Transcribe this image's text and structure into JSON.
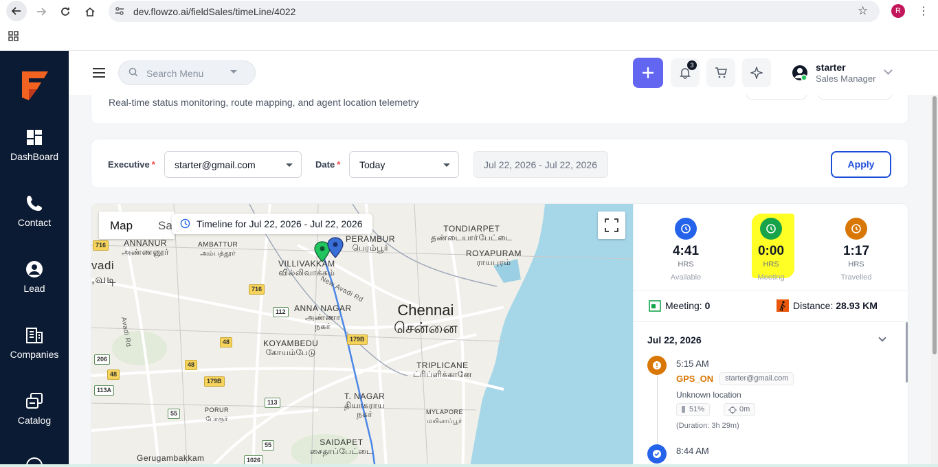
{
  "browser": {
    "url": "dev.flowzo.ai/fieldSales/timeLine/4022",
    "profile_initial": "R"
  },
  "sidebar": {
    "items": [
      {
        "label": "DashBoard",
        "icon": "dashboard-icon"
      },
      {
        "label": "Contact",
        "icon": "phone-icon"
      },
      {
        "label": "Lead",
        "icon": "user-circle-icon"
      },
      {
        "label": "Companies",
        "icon": "building-icon"
      },
      {
        "label": "Catalog",
        "icon": "catalog-icon"
      }
    ]
  },
  "header": {
    "search_placeholder": "Search Menu",
    "notification_count": "3",
    "user_name": "starter",
    "user_role": "Sales Manager"
  },
  "page": {
    "description": "Real-time status monitoring, route mapping, and agent location telemetry"
  },
  "filters": {
    "executive_label": "Executive",
    "executive_value": "starter@gmail.com",
    "date_label": "Date",
    "date_value": "Today",
    "date_range": "Jul 22, 2026 - Jul 22, 2026",
    "apply_label": "Apply"
  },
  "map": {
    "tab_map": "Map",
    "tab_satellite": "Sa",
    "timeline_chip": "Timeline for Jul 22, 2026 - Jul 22, 2026",
    "labels": {
      "annanur": "ANNANUR",
      "annanur_ta": "அண்ணனூர்",
      "ambattur": "AMBATTUR",
      "ambattur_ta": "அம்பத்தூர்",
      "perambur": "PERAMBUR",
      "perambur_ta": "பெரம்பூர்",
      "tondiarpet": "TONDIARPET",
      "tondiarpet_ta": "தண்டையார்பேட்டை",
      "royapuram": "ROYAPURAM",
      "royapuram_ta": "ராயபுரம்",
      "villivakkam": "VILLIVAKKAM",
      "villivakkam_ta": "வில்லிவாக்கம்",
      "new_avadi_rd": "New Avadi Rd",
      "avadi": "vadi",
      "avadi_ta": ",வடி",
      "anna_nagar": "ANNA NAGAR",
      "anna_nagar_ta": "அண்ணா\nநகர்",
      "chennai": "Chennai",
      "chennai_ta": "சென்னை",
      "avadi_rd": "Avadi Rd",
      "koyambedu": "KOYAMBEDU",
      "koyambedu_ta": "கோயம்பேடு",
      "triplicane": "TRIPLICANE",
      "triplicane_ta": "ட்ரிப்ளிக்கானே",
      "t_nagar": "T. NAGAR",
      "t_nagar_ta": "தியாகராய\nநகர்",
      "mylapore": "MYLAPORE",
      "mylapore_ta": "மயிலாப்பூர்",
      "porur": "PORUR",
      "porur_ta": "போரூர்",
      "saidapet": "SAIDAPET",
      "saidapet_ta": "சைதாப்பேட்டை",
      "gerugambakkam": "Gerugambakkam"
    },
    "shields": {
      "s716a": "716",
      "s716b": "716",
      "s112": "112",
      "s179b_a": "179B",
      "s48a": "48",
      "s206": "206",
      "s48b": "48",
      "s48c": "48",
      "s179b_b": "179B",
      "s113a": "113A",
      "s113": "113",
      "s55a": "55",
      "s55b": "55",
      "s1026": "1026"
    }
  },
  "stats": {
    "available": {
      "value": "4:41",
      "unit": "HRS",
      "label": "Available",
      "color": "#2563eb"
    },
    "meeting": {
      "value": "0:00",
      "unit": "HRS",
      "label": "Meeting",
      "color": "#16a34a"
    },
    "travelled": {
      "value": "1:17",
      "unit": "HRS",
      "label": "Travelled",
      "color": "#d97706"
    },
    "meeting_count_label": "Meeting:",
    "meeting_count": "0",
    "distance_label": "Distance:",
    "distance": "28.93 KM"
  },
  "timeline": {
    "date": "Jul 22, 2026",
    "events": [
      {
        "time": "5:15 AM",
        "event": "GPS_ON",
        "user": "starter@gmail.com",
        "location": "Unknown location",
        "battery": "51%",
        "accuracy": "0m",
        "duration": "(Duration: 3h 29m)"
      },
      {
        "time": "8:44 AM"
      }
    ]
  }
}
